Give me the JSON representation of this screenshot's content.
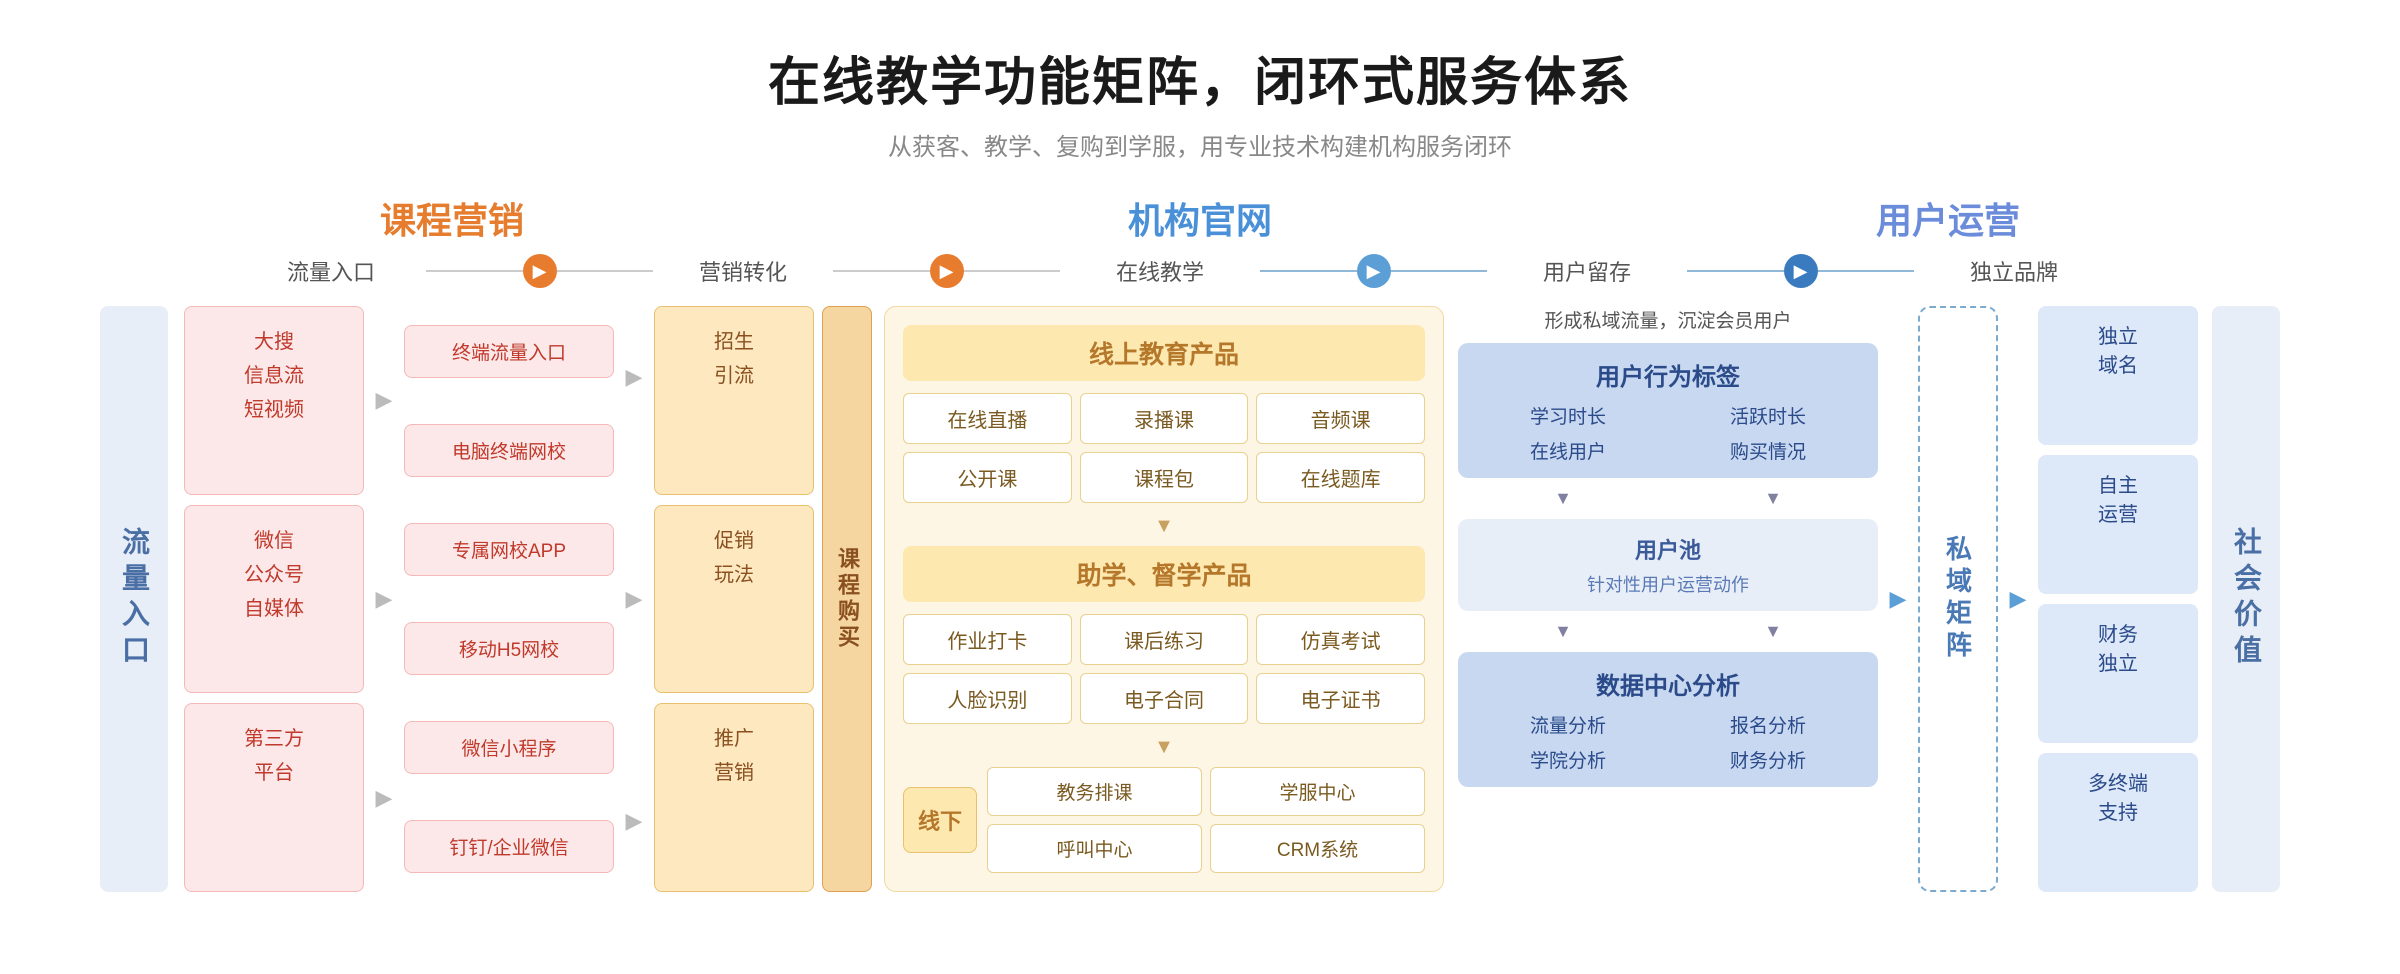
{
  "header": {
    "title": "在线教学功能矩阵，闭环式服务体系",
    "subtitle": "从获客、教学、复购到学服，用专业技术构建机构服务闭环"
  },
  "sections": {
    "marketing": "课程营销",
    "official": "机构官网",
    "userops": "用户运营"
  },
  "flow_steps": {
    "step1": "流量入口",
    "step2": "营销转化",
    "step3": "在线教学",
    "step4": "用户留存",
    "step5": "独立品牌"
  },
  "left_label": "流量入口",
  "traffic_sources": [
    {
      "text": "大搜\n信息流\n短视频"
    },
    {
      "text": "微信\n公众号\n自媒体"
    },
    {
      "text": "第三方\n平台"
    }
  ],
  "marketing_items": [
    {
      "text": "终端流量入口"
    },
    {
      "text": "电脑终端网校"
    },
    {
      "text": "专属网校APP"
    },
    {
      "text": "移动H5网校"
    },
    {
      "text": "微信小程序"
    },
    {
      "text": "钉钉/企业微信"
    }
  ],
  "conversion_items": [
    {
      "text": "招生\n引流"
    },
    {
      "text": "促销\n玩法"
    },
    {
      "text": "推广\n营销"
    }
  ],
  "course_buy_label": "课程购买",
  "online_section": {
    "title": "线上教育产品",
    "items": [
      "在线直播",
      "录播课",
      "音频课",
      "公开课",
      "课程包",
      "在线题库"
    ],
    "assist_title": "助学、督学产品",
    "assist_items": [
      "作业打卡",
      "课后练习",
      "仿真考试",
      "人脸识别",
      "电子合同",
      "电子证书"
    ],
    "offline_label": "线下",
    "offline_items": [
      "教务排课",
      "学服中心",
      "呼叫中心",
      "CRM系统"
    ]
  },
  "user_retention": {
    "desc": "形成私域流量，沉淀会员用户",
    "behavior_title": "用户行为标签",
    "behavior_items": [
      "学习时长",
      "活跃时长",
      "在线用户",
      "购买情况"
    ],
    "pool_title": "用户池",
    "pool_sub": "针对性用户运营动作",
    "data_title": "数据中心分析",
    "data_items": [
      "流量分析",
      "报名分析",
      "学院分析",
      "财务分析"
    ]
  },
  "private_matrix_label": "私域矩阵",
  "brand_items": [
    {
      "text": "独立\n域名"
    },
    {
      "text": "自主\n运营"
    },
    {
      "text": "财务\n独立"
    },
    {
      "text": "多终端\n支持"
    }
  ],
  "social_value": "社会价值"
}
